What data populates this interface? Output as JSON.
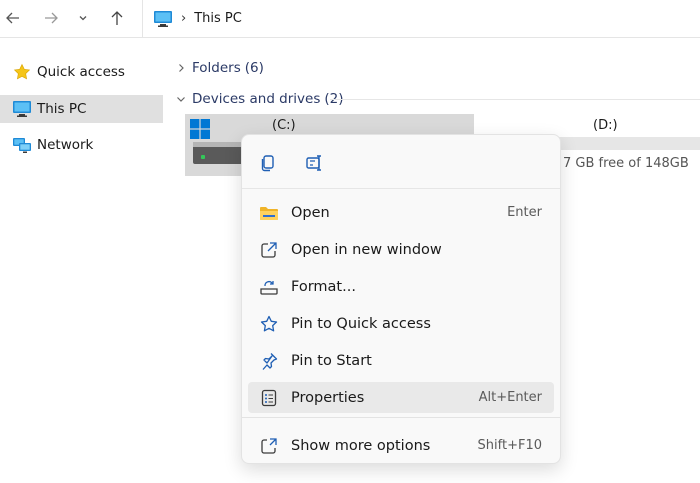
{
  "window": {
    "breadcrumb": [
      "This PC"
    ]
  },
  "toolbar": {
    "back_icon": "arrow-left-icon",
    "forward_icon": "arrow-right-icon",
    "recent_icon": "chevron-down-icon",
    "up_icon": "arrow-up-icon"
  },
  "sidebar": {
    "items": [
      {
        "label": "Quick access",
        "icon": "star-icon",
        "active": false
      },
      {
        "label": "This PC",
        "icon": "monitor-icon",
        "active": true
      },
      {
        "label": "Network",
        "icon": "network-icon",
        "active": false
      }
    ]
  },
  "main": {
    "groups": [
      {
        "label": "Folders",
        "count": "(6)",
        "expanded": false
      },
      {
        "label": "Devices and drives",
        "count": "(2)",
        "expanded": true
      }
    ],
    "drives": [
      {
        "label": "(C:)",
        "selected": true
      },
      {
        "label": "(D:)",
        "free_text": "7 GB free of 148GB"
      }
    ]
  },
  "context_menu": {
    "quick_actions": [
      {
        "name": "copy",
        "icon": "copy-icon"
      },
      {
        "name": "rename",
        "icon": "rename-icon"
      }
    ],
    "items": [
      {
        "label": "Open",
        "shortcut": "Enter",
        "icon": "folder-icon"
      },
      {
        "label": "Open in new window",
        "shortcut": "",
        "icon": "open-external-icon"
      },
      {
        "label": "Format...",
        "shortcut": "",
        "icon": "format-drive-icon"
      },
      {
        "label": "Pin to Quick access",
        "shortcut": "",
        "icon": "star-outline-icon"
      },
      {
        "label": "Pin to Start",
        "shortcut": "",
        "icon": "pin-icon"
      },
      {
        "label": "Properties",
        "shortcut": "Alt+Enter",
        "icon": "properties-icon",
        "highlighted": true
      },
      {
        "label": "Show more options",
        "shortcut": "Shift+F10",
        "icon": "more-options-icon"
      }
    ]
  },
  "colors": {
    "accent": "#0067c0",
    "selection": "#d9d9d9",
    "menu_bg": "#f9f9f9",
    "group_text": "#2b3a66"
  }
}
